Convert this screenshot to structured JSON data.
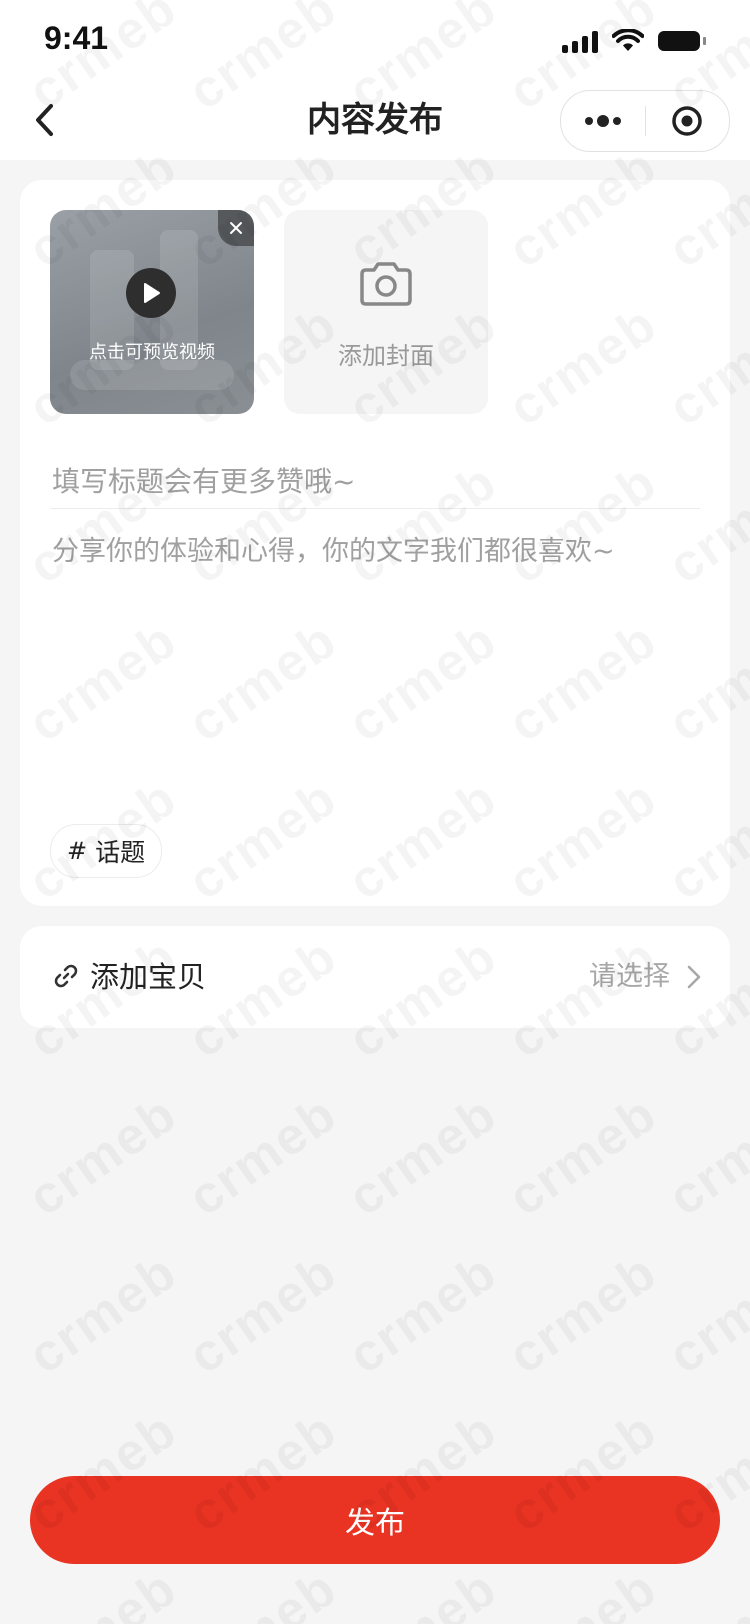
{
  "status_bar": {
    "time": "9:41",
    "icons": [
      "signal-icon",
      "wifi-icon",
      "battery-icon"
    ]
  },
  "nav": {
    "title": "内容发布",
    "back_icon": "chevron-left-icon",
    "capsule_icons": [
      "more-dots-icon",
      "target-icon"
    ]
  },
  "media": {
    "video_preview_label": "点击可预览视频",
    "add_cover_label": "添加封面"
  },
  "form": {
    "title_placeholder": "填写标题会有更多赞哦~",
    "content_placeholder": "分享你的体验和心得，你的文字我们都很喜欢~",
    "topic_label": "话题",
    "topic_symbol": "#"
  },
  "product": {
    "label": "添加宝贝",
    "select_placeholder": "请选择",
    "icon": "link-icon"
  },
  "publish_label": "发布",
  "watermark_text": "crmeb",
  "colors": {
    "accent": "#e93323",
    "background": "#f5f5f5",
    "card": "#ffffff",
    "placeholder": "#a0a0a0"
  }
}
